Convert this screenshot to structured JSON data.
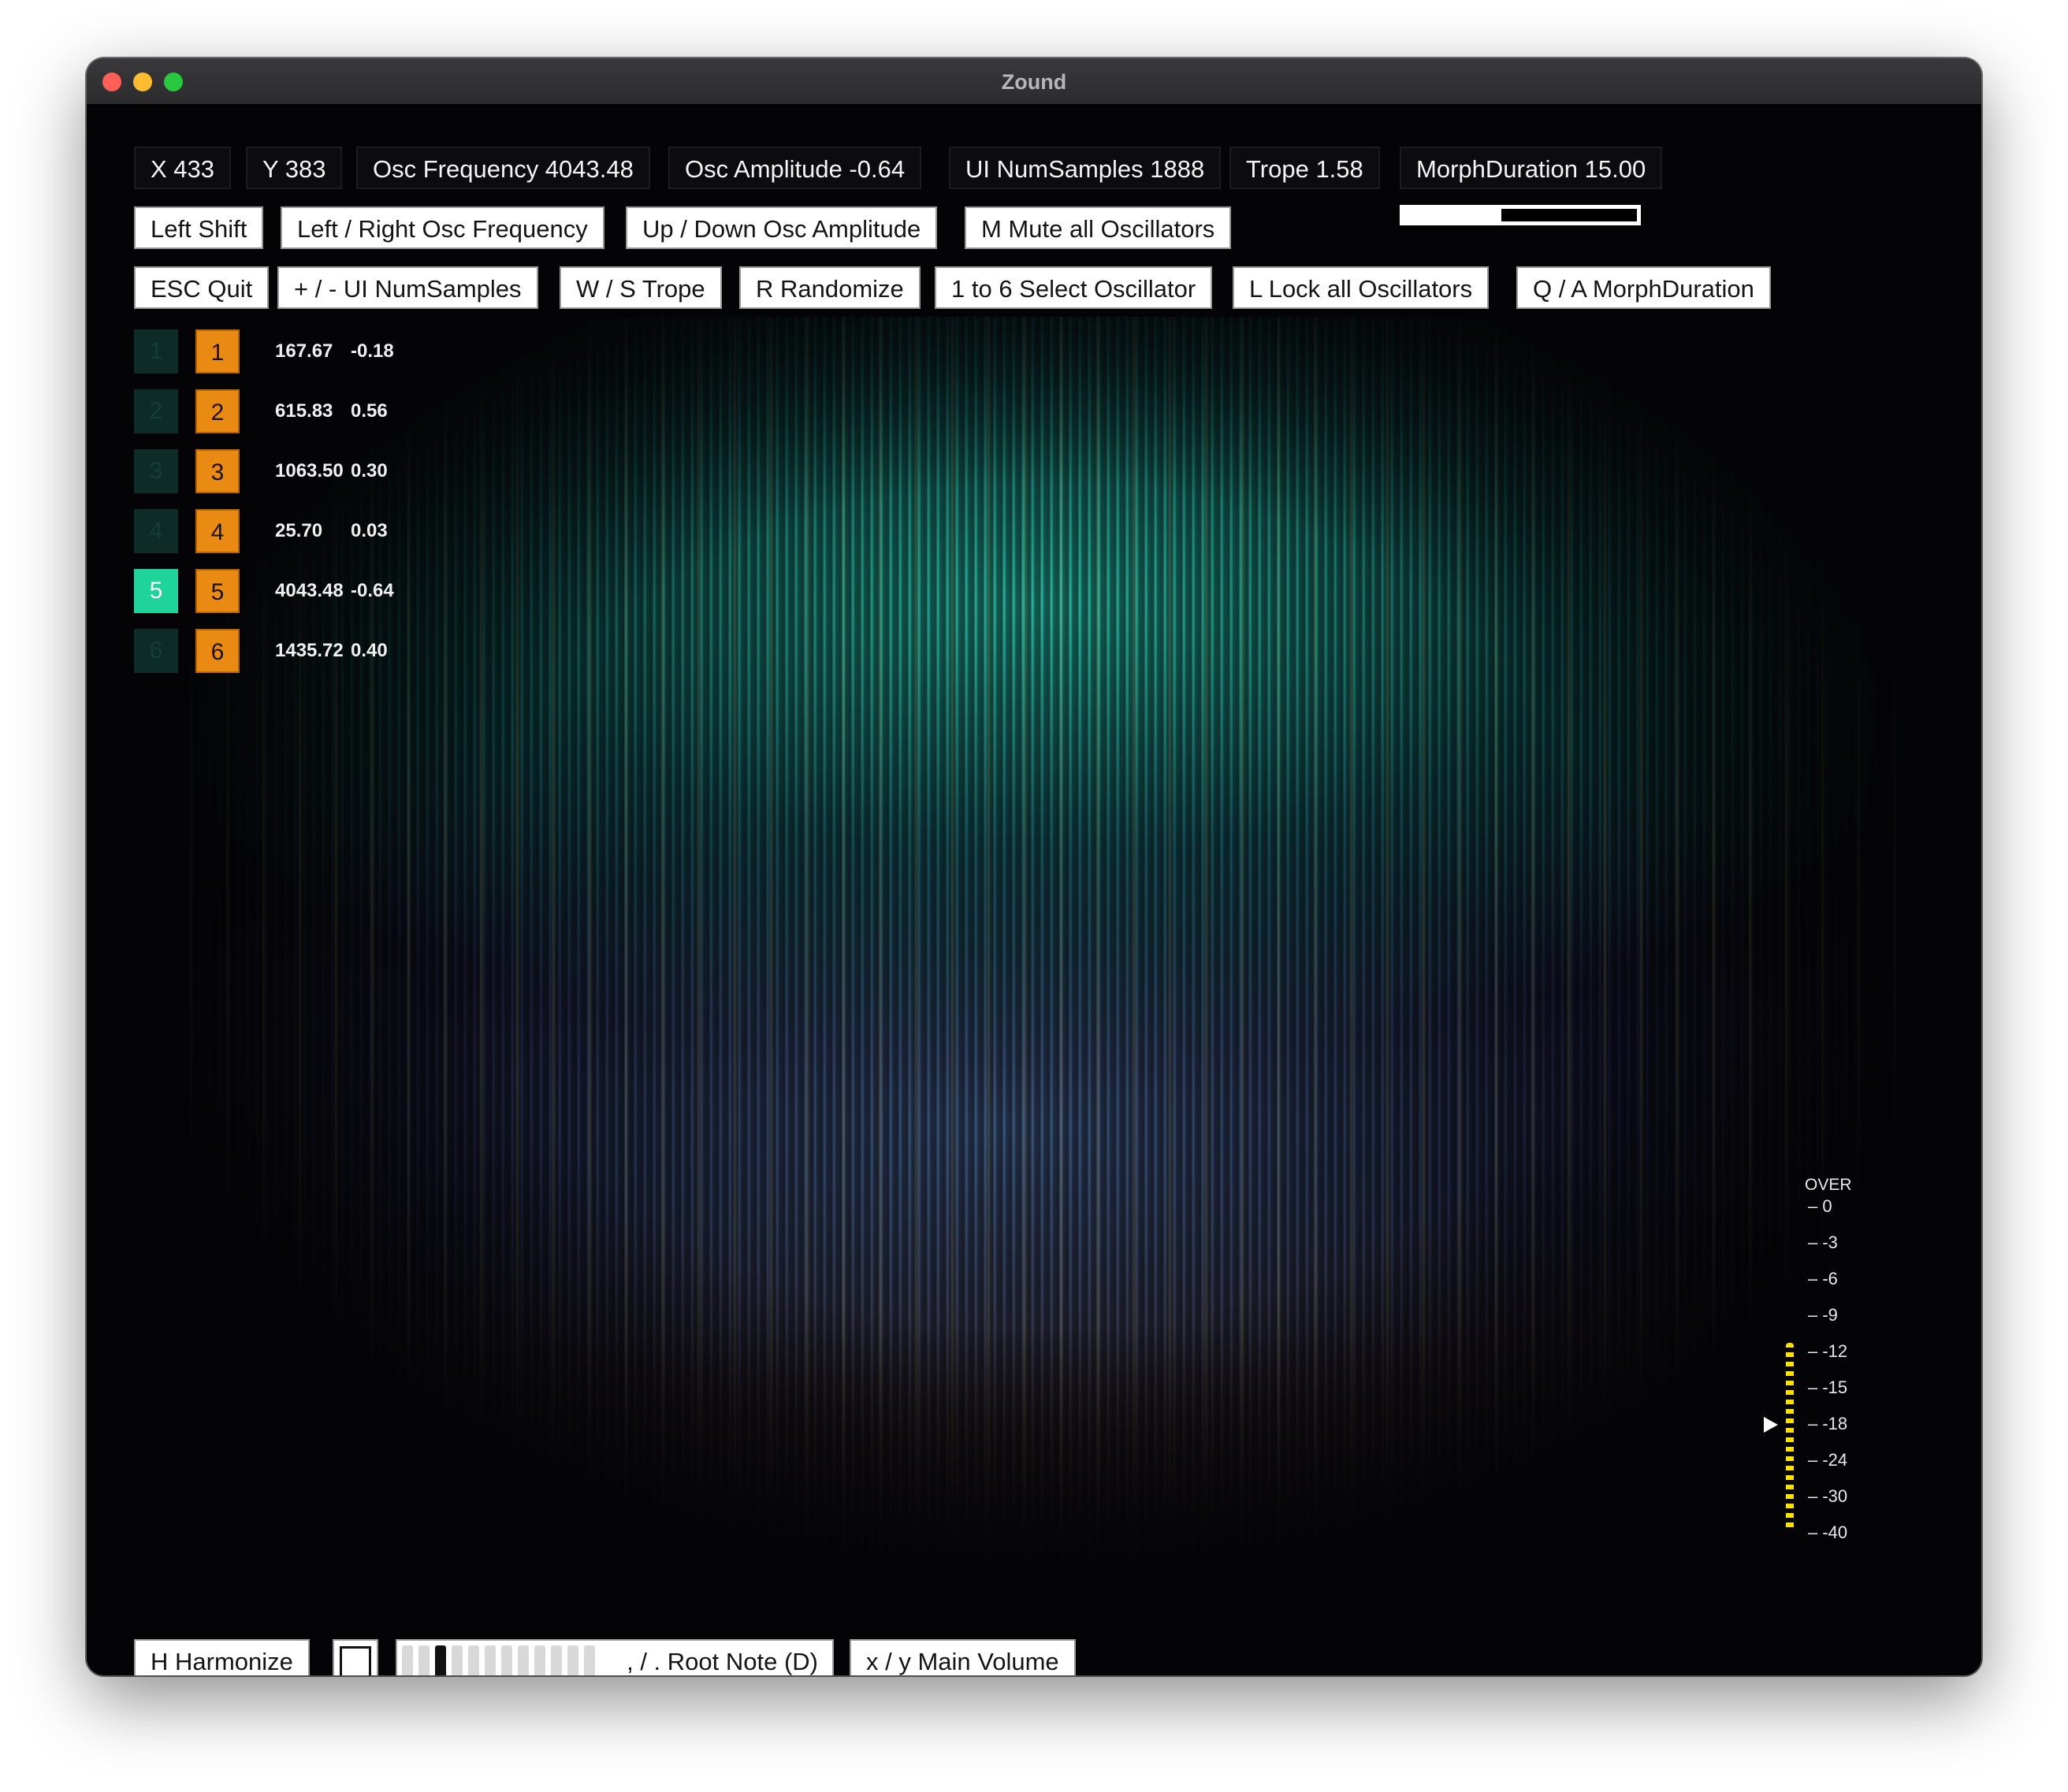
{
  "window": {
    "title": "Zound"
  },
  "status": {
    "x": "X 433",
    "y": "Y 383",
    "osc_frequency": "Osc Frequency 4043.48",
    "osc_amplitude": "Osc Amplitude -0.64",
    "ui_numsamples": "UI NumSamples 1888",
    "trope": "Trope 1.58",
    "morph_duration": "MorphDuration 15.00"
  },
  "morph_progress": 0.42,
  "controls_row1": {
    "left_shift": "Left Shift",
    "left_right": "Left / Right Osc Frequency",
    "up_down": "Up / Down Osc Amplitude",
    "mute": "M Mute all Oscillators"
  },
  "controls_row2": {
    "esc": "ESC Quit",
    "plus_minus": "+ / - UI NumSamples",
    "w_s": "W / S Trope",
    "randomize": "R Randomize",
    "select": "1 to 6 Select Oscillator",
    "lock": "L Lock all Oscillators",
    "q_a": "Q / A MorphDuration"
  },
  "oscillators": [
    {
      "index": "1",
      "freq": "167.67",
      "amp": "-0.18",
      "active": false
    },
    {
      "index": "2",
      "freq": "615.83",
      "amp": "0.56",
      "active": false
    },
    {
      "index": "3",
      "freq": "1063.50",
      "amp": "0.30",
      "active": false
    },
    {
      "index": "4",
      "freq": "25.70",
      "amp": "0.03",
      "active": false
    },
    {
      "index": "5",
      "freq": "4043.48",
      "amp": "-0.64",
      "active": true
    },
    {
      "index": "6",
      "freq": "1435.72",
      "amp": "0.40",
      "active": false
    }
  ],
  "meter": {
    "over_label": "OVER",
    "ticks": [
      "– 0",
      "– -3",
      "– -6",
      "– -9",
      "– -12",
      "– -15",
      "– -18",
      "– -24",
      "– -30",
      "– -40"
    ],
    "level_db": -18,
    "bar_color": "#ffe100"
  },
  "bottom": {
    "harmonize": "H Harmonize",
    "root_note": ", / . Root Note (D)",
    "main_volume": "x / y Main Volume",
    "root_note_index": 2
  },
  "colors": {
    "active_osc": "#1fd49a",
    "osc_button": "#e98a12"
  }
}
